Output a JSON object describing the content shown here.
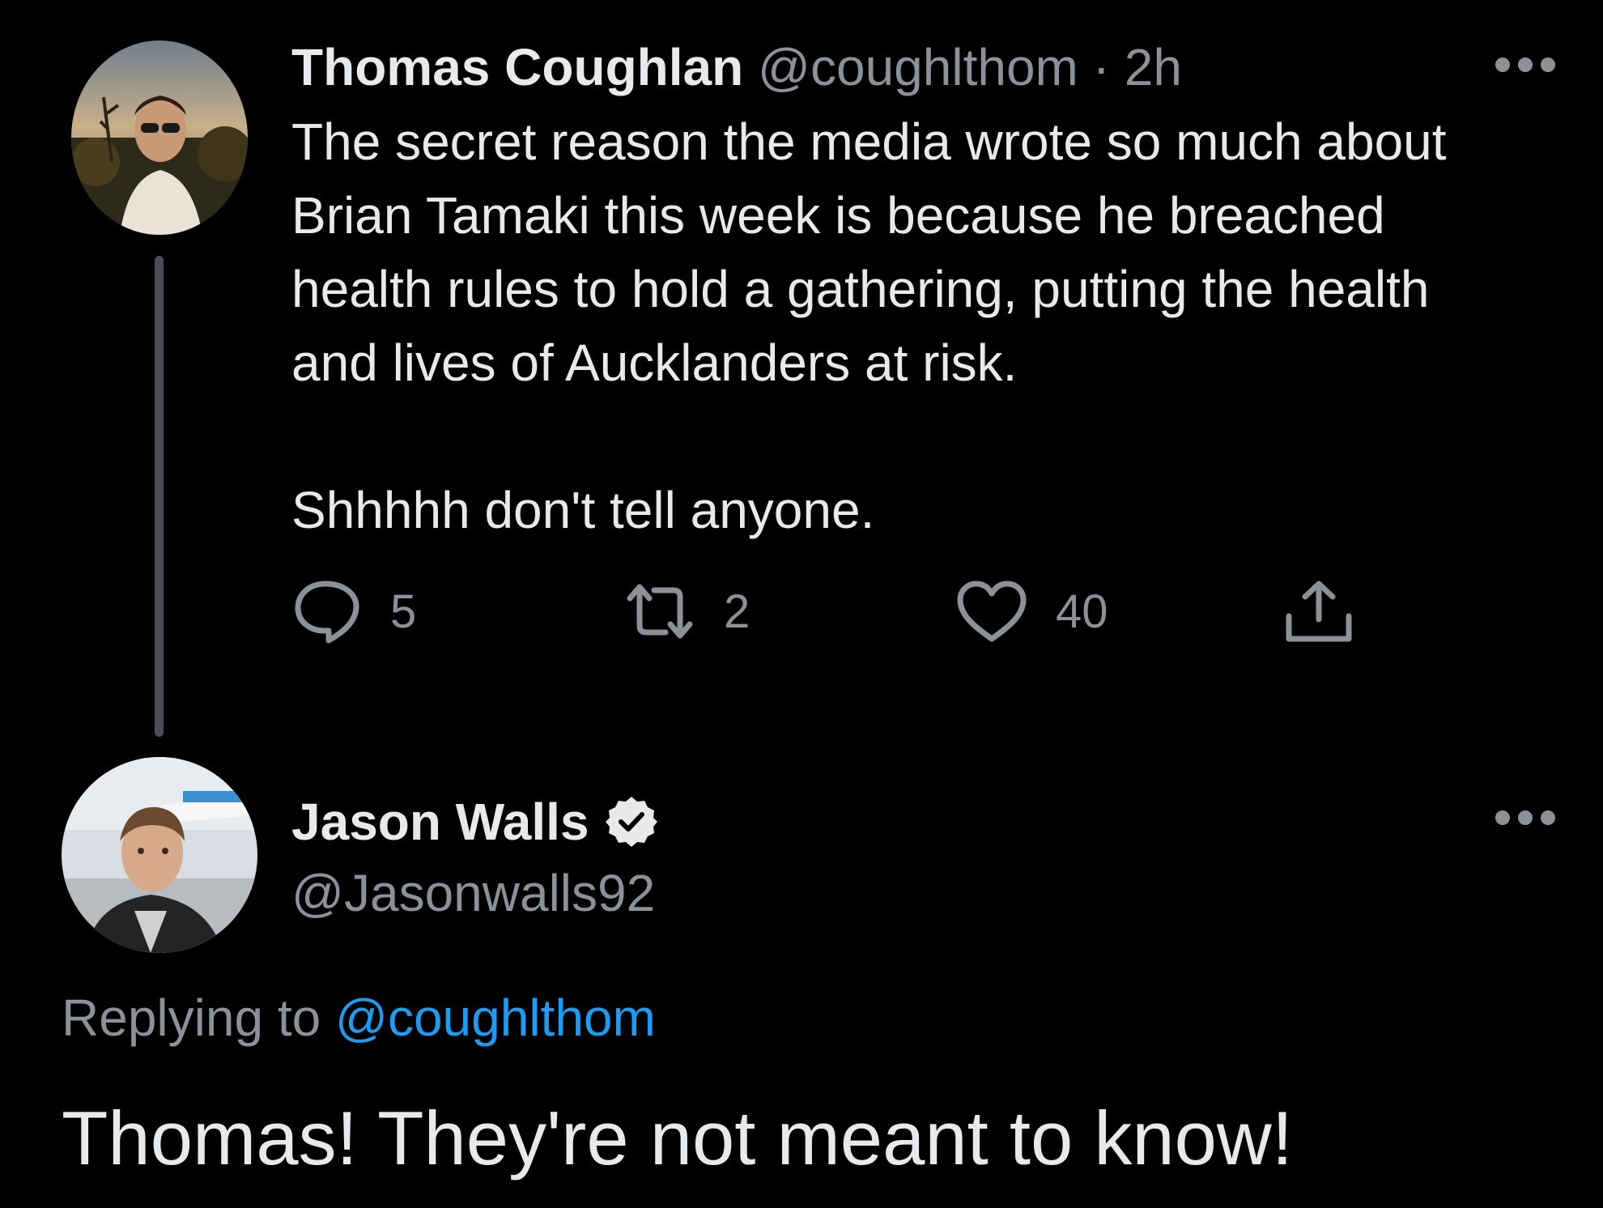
{
  "colors": {
    "background": "#000000",
    "text": "#e7e9ea",
    "muted": "#8b9197",
    "link": "#1d9bf0",
    "thread_line": "#4a4d51"
  },
  "tweet": {
    "display_name": "Thomas Coughlan",
    "handle": "@coughlthom",
    "separator": "·",
    "timestamp": "2h",
    "text_lines": [
      "The secret reason the media wrote so much about",
      "Brian Tamaki this week is because he breached",
      "health rules to hold a gathering, putting the health",
      "and lives of Aucklanders at risk."
    ],
    "text_line_2": "Shhhhh don't tell anyone.",
    "actions": {
      "reply_icon": "comment-bubble-icon",
      "reply_count": "5",
      "retweet_icon": "retweet-icon",
      "retweet_count": "2",
      "like_icon": "heart-icon",
      "like_count": "40",
      "share_icon": "share-upload-icon"
    },
    "more_icon": "more-dots-icon"
  },
  "reply": {
    "display_name": "Jason Walls",
    "verified_icon": "verified-badge-icon",
    "handle": "@Jasonwalls92",
    "replying_to_label": "Replying to",
    "replying_to_handle": "@coughlthom",
    "text": "Thomas! They're not meant to know!",
    "more_icon": "more-dots-icon"
  }
}
